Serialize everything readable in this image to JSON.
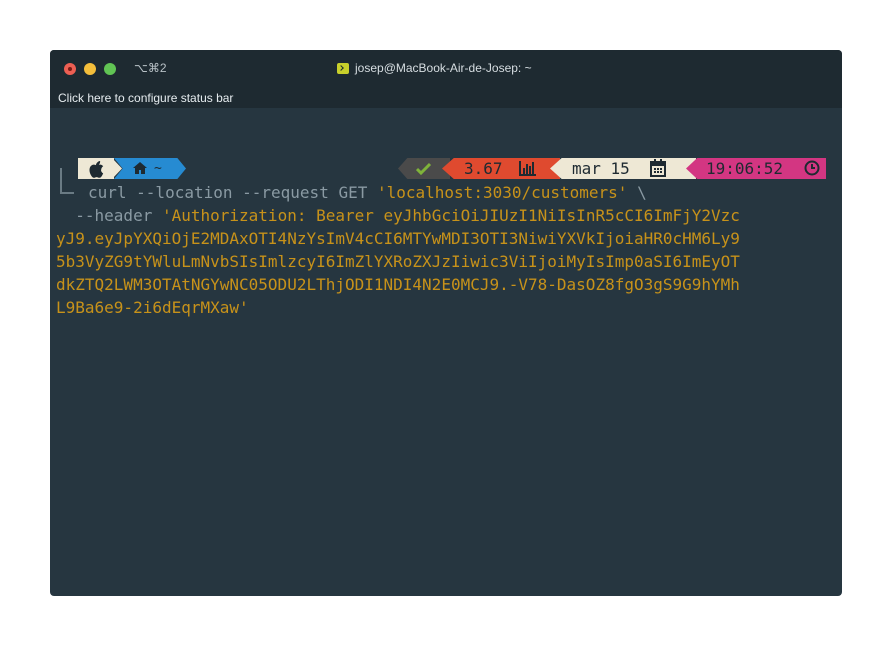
{
  "window": {
    "shortcut": "⌥⌘2",
    "title": "josep@MacBook-Air-de-Josep: ~",
    "status_bar_text": "Click here to configure status bar"
  },
  "prompt": {
    "home_label": "~",
    "load": "3.67",
    "date": "mar 15",
    "time": "19:06:52"
  },
  "colors": {
    "background": "#263640",
    "accent_blue": "#268bd2",
    "accent_red": "#df4a2f",
    "accent_magenta": "#d33682",
    "string": "#c7921a"
  },
  "command": {
    "line1_cmd": "curl --location --request GET ",
    "line1_url": "'localhost:3030/customers'",
    "line1_cont": " \\",
    "line2_flag": "  --header ",
    "line2_str": "'Authorization: Bearer eyJhbGciOiJIUzI1NiIsInR5cCI6ImFjY2Vzc",
    "line3": "yJ9.eyJpYXQiOjE2MDAxOTI4NzYsImV4cCI6MTYwMDI3OTI3NiwiYXVkIjoiaHR0cHM6Ly9",
    "line4": "5b3VyZG9tYWluLmNvbSIsImlzcyI6ImZlYXRoZXJzIiwic3ViIjoiMyIsImp0aSI6ImEyOT",
    "line5": "dkZTQ2LWM3OTAtNGYwNC05ODU2LThjODI1NDI4N2E0MCJ9.-V78-DasOZ8fgO3gS9G9hYMh",
    "line6": "L9Ba6e9-2i6dEqrMXaw'"
  }
}
